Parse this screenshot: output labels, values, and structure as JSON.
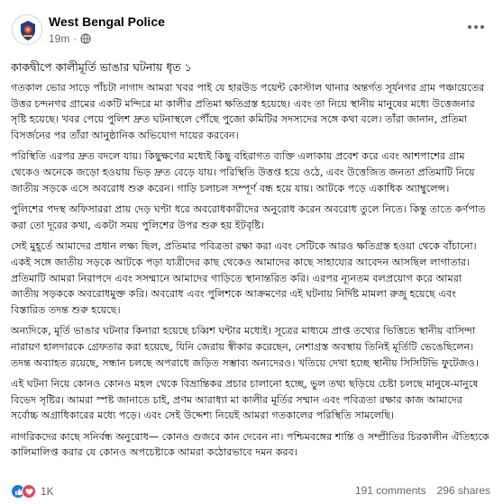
{
  "post": {
    "page_name": "West Bengal Police",
    "time": "19m",
    "privacy_icon": "globe-icon",
    "more_icon": "more-options-icon",
    "title": "কাকদ্বীপে কালীমূর্তি ভাঙার ঘটনায় ধৃত ১",
    "paragraphs": [
      "গতকাল ভোর সাড়ে পাঁচটা নাগাদ আমরা খবর পাই যে হারউড পয়েন্ট কোস্টাল থানার অন্তর্গত সূর্যনগর গ্রাম পঞ্চায়েতের উত্তর চন্দনগর গ্রামের একটি মন্দিরে মা কালীর প্রতিমা ক্ষতিগ্রস্ত হয়েছে। এবং তা নিয়ে স্থানীয় মানুষের মধ্যে উত্তেজনার সৃষ্টি হয়েছে। খবর পেয়ে পুলিশ দ্রুত ঘটনাস্থলে পৌঁছে পুজো কমিটির সদস্যদের সঙ্গে কথা বলে। তাঁরা জানান, প্রতিমা বিসর্জনের পর তাঁরা আনুষ্ঠানিক অভিযোগ দায়ের করবেন।",
      "পরিস্থিতি এরপর দ্রুত বদলে যায়। কিছুক্ষণের মধ্যেই কিছু বহিরাগত ব্যক্তি এলাকায় প্রবেশ করে এবং আশপাশের গ্রাম থেকেও অনেকে জড়ো হওয়ায় ভিড় দ্রুত বেড়ে যায়। পরিস্থিতি উত্তপ্ত হয়ে ওঠে, এবং উত্তেজিত জনতা প্রতিমাটি নিয়ে জাতীয় সড়কে এসে অবরোধ শুরু করেন। গাড়ি চলাচল সম্পূর্ণ বন্ধ হয়ে যায়। আটকে পড়ে একাধিক অ্যাম্বুলেন্স।",
      "পুলিশের পদস্থ অফিসাররা প্রায় দেড় ঘণ্টা ধরে অবরোধকারীদের অনুরোধ করেন অবরোধ তুলে নিতে। কিন্তু তাতে কর্ণপাত করা তো দূরের কথা, একটা সময় পুলিশের উপর শুরু হয় ইটবৃষ্টি।",
      "সেই মুহূর্তে আমাদের প্রধান লক্ষ্য ছিল, প্রতিমার পবিত্রতা রক্ষা করা এবং সেটিকে আরও ক্ষতিগ্রস্ত হওয়া থেকে বাঁচানো। একই সঙ্গে জাতীয় সড়কে আটকে পড়া যাত্রীদের কাছ থেকেও আমাদের কাছে সাহায্যের আবেদন আসছিল লাগাতার। প্রতিমাটি আমরা নিরাপদে এবং সসম্মানে আমাদের গাড়িতে স্থানান্তরিত করি। এরপর ন্যূনতম বলপ্রয়োগ করে আমরা জাতীয় সড়ককে অবরোধমুক্ত করি। অবরোধ এবং পুলিশকে আক্রমণের এই ঘটনায় নির্দিষ্ট মামলা রুজু হয়েছে এবং বিস্তারিত তদন্ত শুরু হয়েছে।",
      "অন্যদিকে, মূর্তি ভাঙার ঘটনার কিনারা হয়েছে চব্বিশ ঘন্টার মধ্যেই। সূত্রের মাধ্যমে প্রাপ্ত তথ্যের ভিত্তিতে স্থানীয় বাসিন্দা নারায়ণ হালদারকে গ্রেফতার করা হয়েছে, যিনি জেরায় স্বীকার করেছেন, নেশাগ্রস্ত অবস্থায় তিনিই মূর্তিটি ভেঙেছিলেন। তদন্ত অব্যাহত রয়েছে, সন্ধান চলছে অপরাধে জড়িত সম্ভাব্য অন্যদেরও। খতিয়ে দেখা হচ্ছে স্থানীয় সিসিটিভি ফুটেজও।",
      "এই ঘটনা নিয়ে কোনও কোনও মহল থেকে বিভ্রান্তিকর প্রচার চালানো হচ্ছে, ভুল তথ্য ছড়িয়ে চেষ্টা চলছে মানুষে-মানুষে বিভেদ সৃষ্টির। আমরা স্পষ্ট জানাতে চাই, প্রণম আরাধ্যা মা কালীর মূর্তির সম্মান এবং পবিত্রতা রক্ষার কাজ আমাদের সর্বোচ্চ অগ্রাধিকারের মধ্যে পড়ে। এবং সেই উদ্দেশ্য নিয়েই আমরা গতকালের পরিস্থিতি সামলেছি।",
      "নাগরিকদের কাছে সনির্বন্ধ অনুরোধ— কোনও গুজবে কান দেবেন না। পশ্চিমবঙ্গের শান্তি ও সম্প্রীতির চিরকালীন ঐতিহ্যকে কালিমালিপ্ত করার যে কোনও অপচেষ্টাকে আমরা কঠোরভাবে দমন করব।"
    ]
  },
  "footer": {
    "reaction_icons": [
      "like-icon",
      "love-icon"
    ],
    "reaction_count": "1K",
    "comments": "191 comments",
    "shares": "296 shares"
  },
  "colors": {
    "text": "#050505",
    "secondary": "#65676b",
    "like": "#1b74e4",
    "love": "#f33e58"
  }
}
